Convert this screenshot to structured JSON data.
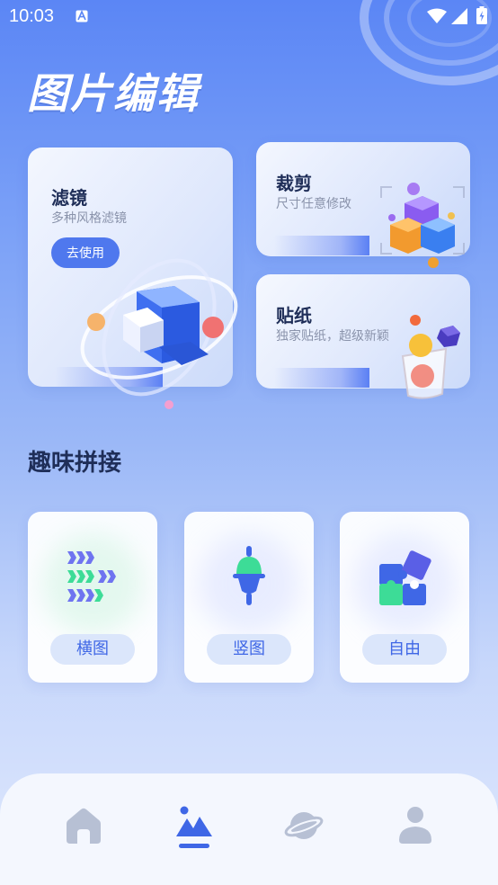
{
  "status_bar": {
    "time": "10:03"
  },
  "header": {
    "title": "图片编辑"
  },
  "features": {
    "filter": {
      "title": "滤镜",
      "subtitle": "多种风格滤镜",
      "button_label": "去使用"
    },
    "crop": {
      "title": "裁剪",
      "subtitle": "尺寸任意修改"
    },
    "sticker": {
      "title": "贴纸",
      "subtitle": "独家贴纸，超级新颖"
    }
  },
  "splice_section": {
    "title": "趣味拼接",
    "items": [
      {
        "label": "横图",
        "icon": "horizontal-arrows-icon"
      },
      {
        "label": "竖图",
        "icon": "vertical-plug-icon"
      },
      {
        "label": "自由",
        "icon": "puzzle-icon"
      }
    ]
  },
  "bottom_nav": {
    "items": [
      {
        "icon": "home-icon",
        "active": false
      },
      {
        "icon": "mountain-photo-icon",
        "active": true
      },
      {
        "icon": "planet-icon",
        "active": false
      },
      {
        "icon": "user-icon",
        "active": false
      }
    ]
  },
  "colors": {
    "accent": "#4f78ee",
    "active_nav": "#3f67e6",
    "inactive_nav": "#b7c0d4",
    "pill_bg": "#dbe6fb",
    "pill_text": "#3f67e6",
    "green": "#3ddc97"
  }
}
